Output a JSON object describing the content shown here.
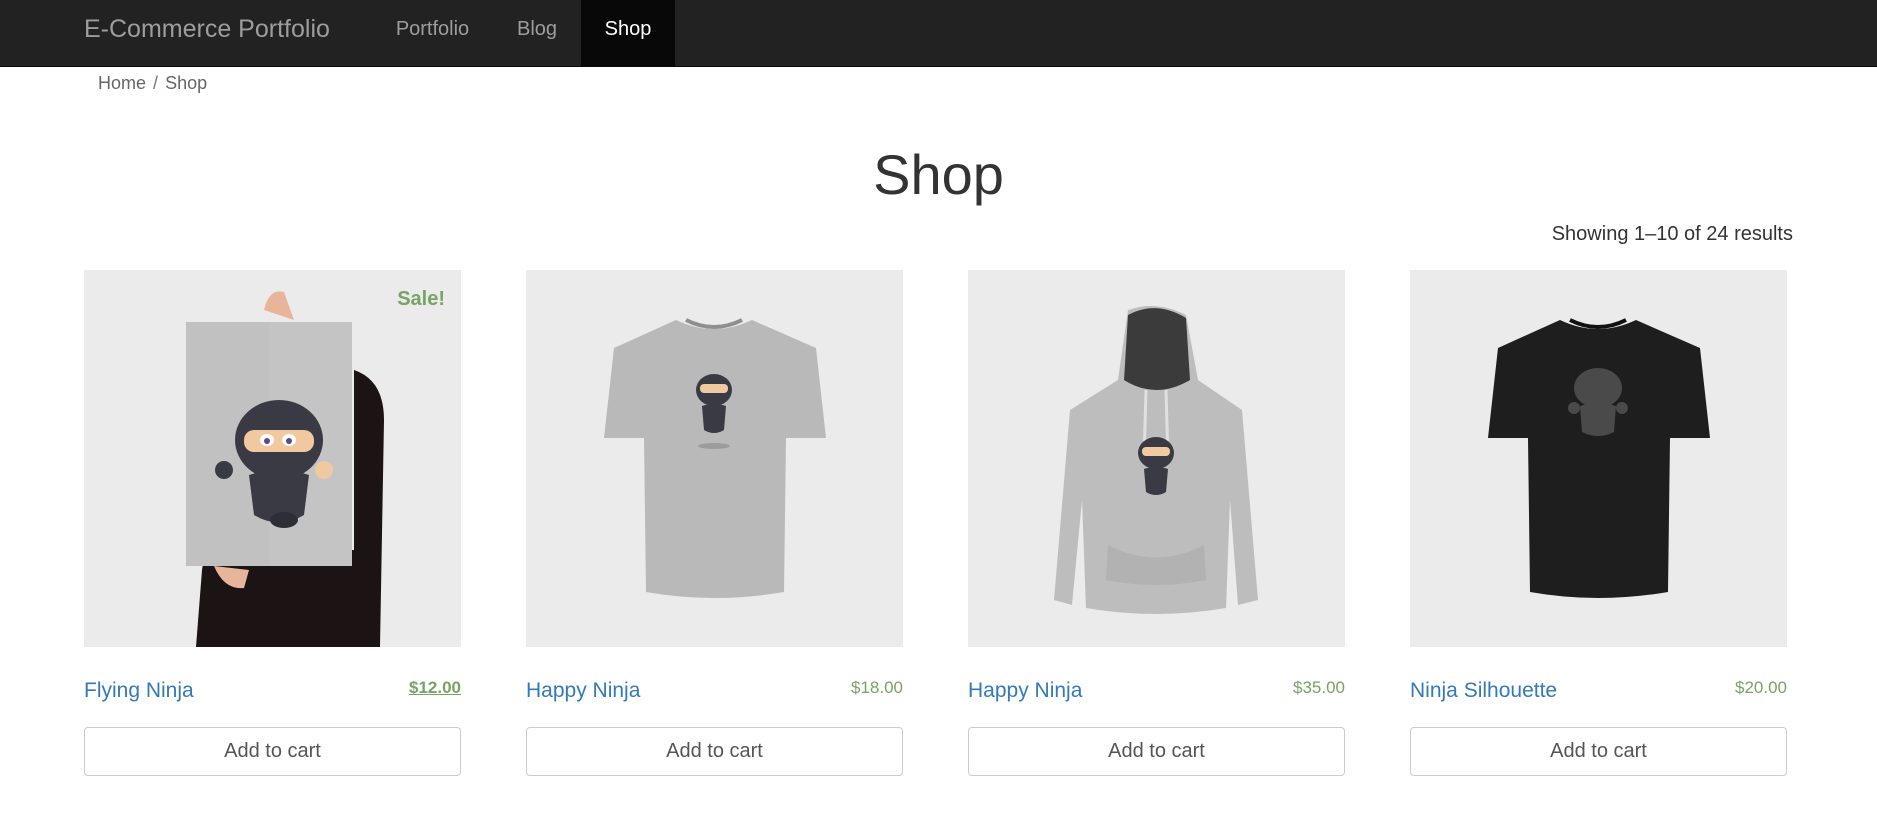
{
  "navbar": {
    "brand": "E-Commerce Portfolio",
    "links": [
      {
        "label": "Portfolio",
        "active": false
      },
      {
        "label": "Blog",
        "active": false
      },
      {
        "label": "Shop",
        "active": true
      }
    ]
  },
  "breadcrumb": {
    "home": "Home",
    "separator": "/",
    "current": "Shop"
  },
  "page": {
    "title": "Shop",
    "result_count": "Showing 1–10 of 24 results"
  },
  "products": [
    {
      "title": "Flying Ninja",
      "price": "$12.00",
      "on_sale": true,
      "sale_badge": "Sale!",
      "button": "Add to cart",
      "image": "ninja-poster-image"
    },
    {
      "title": "Happy Ninja",
      "price": "$18.00",
      "on_sale": false,
      "button": "Add to cart",
      "image": "grey-tshirt-ninja-image"
    },
    {
      "title": "Happy Ninja",
      "price": "$35.00",
      "on_sale": false,
      "button": "Add to cart",
      "image": "grey-hoodie-ninja-image"
    },
    {
      "title": "Ninja Silhouette",
      "price": "$20.00",
      "on_sale": false,
      "button": "Add to cart",
      "image": "black-tshirt-silhouette-image"
    }
  ],
  "colors": {
    "navbar": "#222222",
    "link": "#337ab7",
    "price": "#77a464",
    "image_bg": "#ebebeb"
  }
}
